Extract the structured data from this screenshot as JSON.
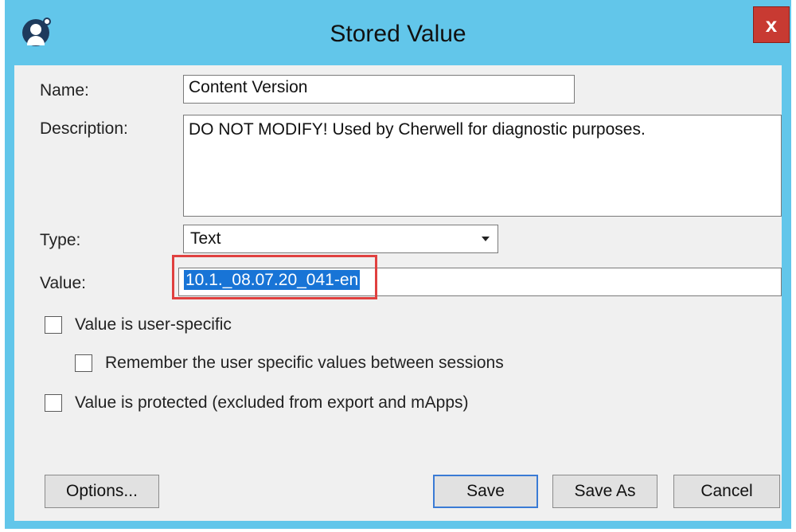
{
  "window": {
    "title": "Stored Value",
    "close_label": "x"
  },
  "form": {
    "name_label": "Name:",
    "name_value": "Content Version",
    "description_label": "Description:",
    "description_value": "DO NOT MODIFY! Used by Cherwell for diagnostic purposes.",
    "type_label": "Type:",
    "type_value": "Text",
    "value_label": "Value:",
    "value_value": "10.1._08.07.20_041-en"
  },
  "options": {
    "user_specific": {
      "label": "Value is user-specific",
      "checked": false
    },
    "remember_sessions": {
      "label": "Remember the user specific values between sessions",
      "checked": false
    },
    "protected": {
      "label": "Value is protected (excluded from export and mApps)",
      "checked": false
    }
  },
  "buttons": {
    "options": "Options...",
    "save": "Save",
    "save_as": "Save As",
    "cancel": "Cancel"
  },
  "colors": {
    "title_bar": "#62c6ea",
    "close_button": "#c83a32",
    "selection": "#1874d6",
    "highlight_box": "#e0403f"
  }
}
